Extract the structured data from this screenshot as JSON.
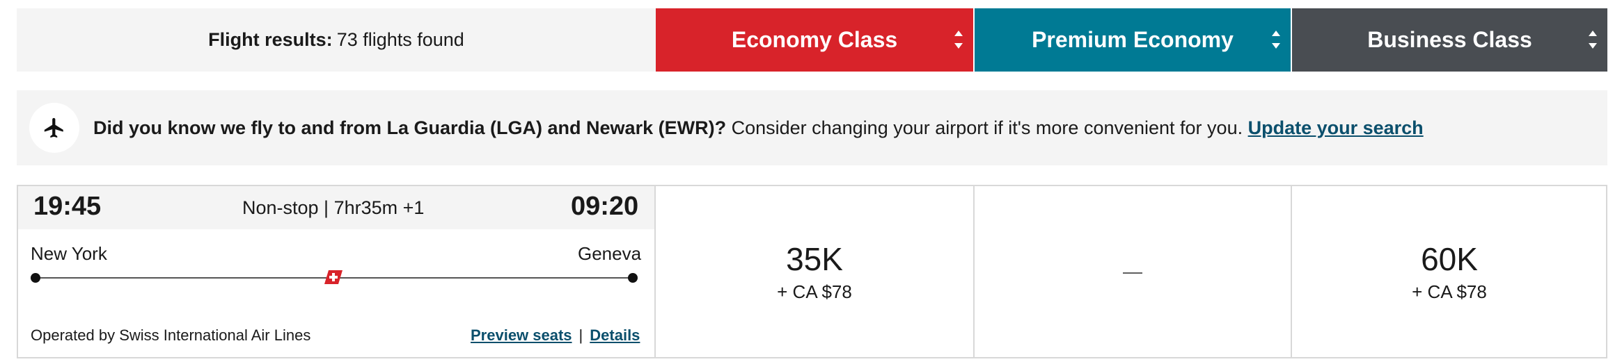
{
  "summary": {
    "label": "Flight results:",
    "value": "73 flights found"
  },
  "cabins": [
    {
      "name": "Economy Class",
      "color": "#d8232a"
    },
    {
      "name": "Premium Economy",
      "color": "#007a94"
    },
    {
      "name": "Business Class",
      "color": "#494d52"
    }
  ],
  "banner": {
    "icon": "plane-icon",
    "bold_text": "Did you know we fly to and from La Guardia (LGA) and Newark (EWR)?",
    "text": " Consider changing your airport if it's more convenient for you. ",
    "link": "Update your search"
  },
  "flight": {
    "depart_time": "19:45",
    "arrive_time": "09:20",
    "duration": "Non-stop | 7hr35m +1",
    "from_city": "New York",
    "to_city": "Geneva",
    "operated_by": "Operated by Swiss International Air Lines",
    "preview_link": "Preview seats",
    "separator": "|",
    "details_link": "Details",
    "fares": {
      "economy": {
        "points": "35K",
        "tax": "+ CA $78"
      },
      "premium": {
        "unavailable": "—"
      },
      "business": {
        "points": "60K",
        "tax": "+ CA $78"
      }
    }
  }
}
